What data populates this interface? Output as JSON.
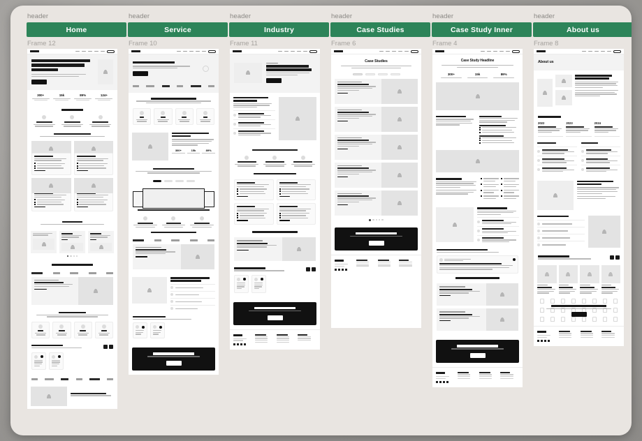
{
  "board": {
    "background_color": "#e9e5e1",
    "accent_color": "#2d8459",
    "columns": [
      {
        "header_label": "header",
        "page_name": "Home",
        "frame_label": "Frame 12",
        "sections": [
          "navbar",
          "hero-headline",
          "stats",
          "benefits",
          "services-for-success",
          "industries",
          "top-notch-case-studies",
          "why-choose-us",
          "testimonials",
          "logos",
          "about-the-company"
        ],
        "headings": {
          "hero": "Let the user know what this business is about",
          "benefits": "Benefits",
          "services": "Services for success",
          "industries": "Industries",
          "case_studies": "Top-notch Case Studies",
          "why": "Why choose us",
          "testimonials": "Testimonials",
          "about": "About the company"
        },
        "stats": [
          {
            "value": "300+"
          },
          {
            "value": "15k"
          },
          {
            "value": "89%"
          },
          {
            "value": "124+"
          }
        ]
      },
      {
        "header_label": "header",
        "page_name": "Service",
        "frame_label": "Frame 10",
        "sections": [
          "navbar",
          "hero-headline",
          "logo-strip",
          "make-more",
          "main-benefit",
          "features",
          "laptop-mockup",
          "case-studies",
          "our-process",
          "testimonials",
          "cta"
        ],
        "headings": {
          "hero": "Service Headline",
          "make_more": "Make more with this service",
          "main_benefit": "Main benefit of this service",
          "features": "Features of the service",
          "case_studies": "Case Studies for this Service",
          "process": "Our process, which helps you succeed",
          "testimonials": "Testimonials"
        },
        "stats": [
          {
            "value": "300+"
          },
          {
            "value": "15k"
          },
          {
            "value": "89%"
          }
        ]
      },
      {
        "header_label": "header",
        "page_name": "Industry",
        "frame_label": "Frame 11",
        "sections": [
          "navbar",
          "hero-headline",
          "industry-overview",
          "results-benefits",
          "services-for-industry",
          "case-studies",
          "testimonials",
          "cta",
          "footer"
        ],
        "headings": {
          "hero": "Some headline about the industry",
          "overview": "Industry overview and target clients",
          "results": "Results/benefits we provide",
          "services": "Services for this Industry",
          "case_studies": "Case Studies for this Industry",
          "testimonials": "Testimonials",
          "cta": "Strong call to action"
        }
      },
      {
        "header_label": "header",
        "page_name": "Case Studies",
        "frame_label": "Frame 6",
        "sections": [
          "navbar",
          "page-title",
          "filters",
          "case-study-list",
          "pagination",
          "cta",
          "footer"
        ],
        "headings": {
          "title": "Case Studies",
          "cta": "Strong call to action"
        },
        "case_study_count": 5
      },
      {
        "header_label": "header",
        "page_name": "Case Study Inner",
        "frame_label": "Frame 4",
        "sections": [
          "navbar",
          "headline",
          "stats",
          "hero-image",
          "the-challenges",
          "the-solution",
          "the-outcomes",
          "client-quote",
          "similar-case-studies",
          "cta",
          "footer"
        ],
        "headings": {
          "hero": "Case Study Headline",
          "challenges": "The Challenges",
          "solution": "The Solution",
          "outcomes": "The Outcomes",
          "client": "What does the client think?",
          "similar": "Similar Case Studies",
          "cta": "Strong call to action"
        },
        "stats": [
          {
            "value": "300+"
          },
          {
            "value": "15k"
          },
          {
            "value": "89%"
          }
        ]
      },
      {
        "header_label": "header",
        "page_name": "About us",
        "frame_label": "Frame 8",
        "sections": [
          "navbar",
          "page-title",
          "overview",
          "our-story",
          "mission-vision",
          "more-about-the-company",
          "our-core-values",
          "meet-the-team",
          "join-the-team",
          "footer"
        ],
        "headings": {
          "title": "About us",
          "overview": "Overview and important information",
          "story": "Our Story",
          "mission": "Mission",
          "vision": "Vision",
          "more": "More about the company",
          "values": "Our Core Values",
          "team": "Meet the team",
          "join": "Want to be part of the team?"
        },
        "timeline": [
          {
            "year": "2022",
            "label": "Feature element"
          },
          {
            "year": "2023",
            "label": "Feature element"
          },
          {
            "year": "2024",
            "label": "Feature element"
          }
        ]
      }
    ]
  }
}
